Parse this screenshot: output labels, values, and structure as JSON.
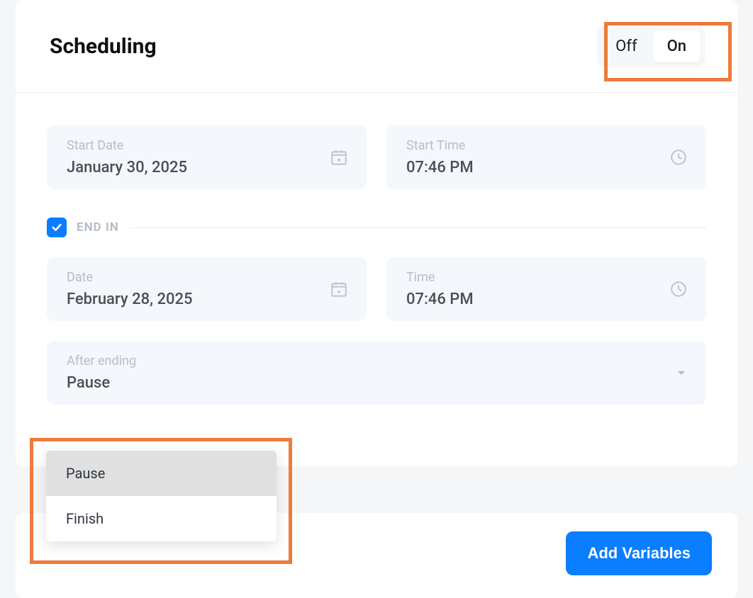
{
  "panel": {
    "title": "Scheduling",
    "toggle": {
      "off_label": "Off",
      "on_label": "On",
      "selected": "On"
    }
  },
  "start": {
    "date_label": "Start Date",
    "date_value": "January 30, 2025",
    "time_label": "Start Time",
    "time_value": "07:46 PM"
  },
  "end_section": {
    "checkbox_checked": true,
    "label": "END IN"
  },
  "end": {
    "date_label": "Date",
    "date_value": "February 28, 2025",
    "time_label": "Time",
    "time_value": "07:46 PM"
  },
  "after_ending": {
    "label": "After ending",
    "value": "Pause",
    "options": [
      "Pause",
      "Finish"
    ]
  },
  "bottom": {
    "add_variables_label": "Add Variables"
  }
}
